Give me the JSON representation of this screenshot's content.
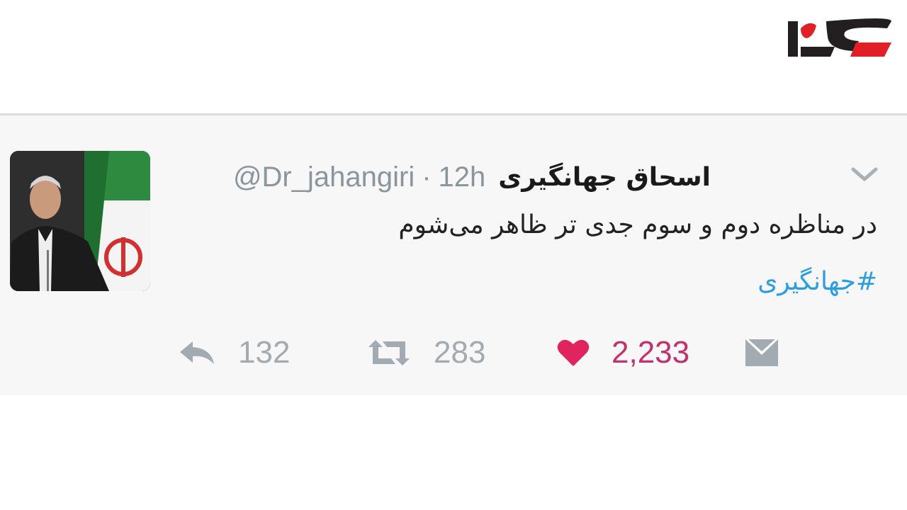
{
  "brand": {
    "logo_icon": "site-logo",
    "colors": {
      "logo_red": "#e11f26",
      "logo_dark": "#231f20"
    }
  },
  "tweet": {
    "display_name": "اسحاق جهانگیری",
    "handle": "@Dr_jahangiri",
    "separator": "·",
    "time": "12h",
    "text": "در مناظره دوم و سوم جدی تر ظاهر می‌شوم",
    "hashtag": "#جهانگیری",
    "avatar_icon": "avatar-photo",
    "menu_icon": "chevron-down-icon",
    "actions": {
      "reply": {
        "icon": "reply-icon",
        "count": "132"
      },
      "retweet": {
        "icon": "retweet-icon",
        "count": "283"
      },
      "like": {
        "icon": "heart-icon",
        "count": "2,233",
        "color": "#e0245e"
      },
      "dm": {
        "icon": "envelope-icon"
      }
    },
    "colors": {
      "link": "#2b9de0",
      "muted": "#8a959e",
      "card_bg": "#f7f7f7"
    }
  }
}
